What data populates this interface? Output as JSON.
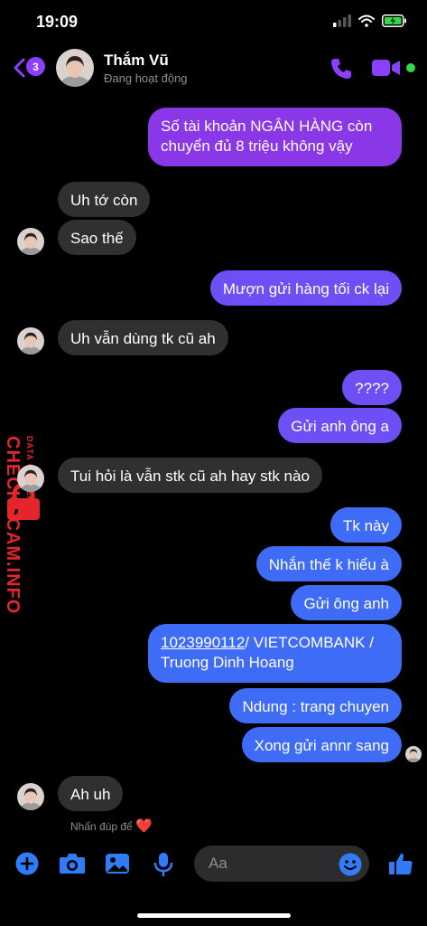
{
  "status_bar": {
    "time": "19:09"
  },
  "header": {
    "unread_count": "3",
    "contact_name": "Thắm Vũ",
    "contact_status": "Đang hoạt động"
  },
  "messages": [
    {
      "side": "out",
      "text": "Số tài khoản NGÂN HÀNG còn chuyển đủ 8 triệu không vậy"
    },
    {
      "side": "in",
      "text": "Uh tớ còn"
    },
    {
      "side": "in",
      "text": "Sao thế"
    },
    {
      "side": "out",
      "text": "Mượn gửi hàng tối ck lại"
    },
    {
      "side": "in",
      "text": "Uh vẫn dùng tk cũ ah"
    },
    {
      "side": "out",
      "text": "????"
    },
    {
      "side": "out",
      "text": "Gửi anh ông a"
    },
    {
      "side": "in",
      "text": "Tui hỏi là vẫn stk cũ ah hay stk nào"
    },
    {
      "side": "out",
      "text": "Tk này"
    },
    {
      "side": "out",
      "text": "Nhắn thế k hiểu à"
    },
    {
      "side": "out",
      "text": "Gửi ông anh"
    },
    {
      "side": "out",
      "account_number": "1023990112",
      "text": "/ VIETCOMBANK /",
      "text2": "Truong Dinh Hoang"
    },
    {
      "side": "out",
      "text": "Ndung : trang chuyen"
    },
    {
      "side": "out",
      "text": "Xong gửi annr sang"
    },
    {
      "side": "in",
      "text": "Ah uh"
    }
  ],
  "reaction_hint": "Nhấn đúp để",
  "reaction_emoji": "❤️",
  "composer": {
    "placeholder": "Aa"
  },
  "watermark": {
    "main": "CHECKSCAM.INFO",
    "sub": "DATA CENTER"
  },
  "colors": {
    "bubble_purple": "#8a37e8",
    "bubble_violet": "#6d4ff5",
    "bubble_blue": "#3f6cf6",
    "bubble_incoming": "#303030",
    "accent": "#8a3ffc",
    "composer_blue": "#2f7cf6",
    "watermark_red": "#e3262d"
  },
  "icons": [
    "back-chevron-icon",
    "phone-icon",
    "video-camera-icon",
    "plus-icon",
    "camera-icon",
    "image-icon",
    "microphone-icon",
    "emoji-icon",
    "thumbs-up-icon"
  ]
}
